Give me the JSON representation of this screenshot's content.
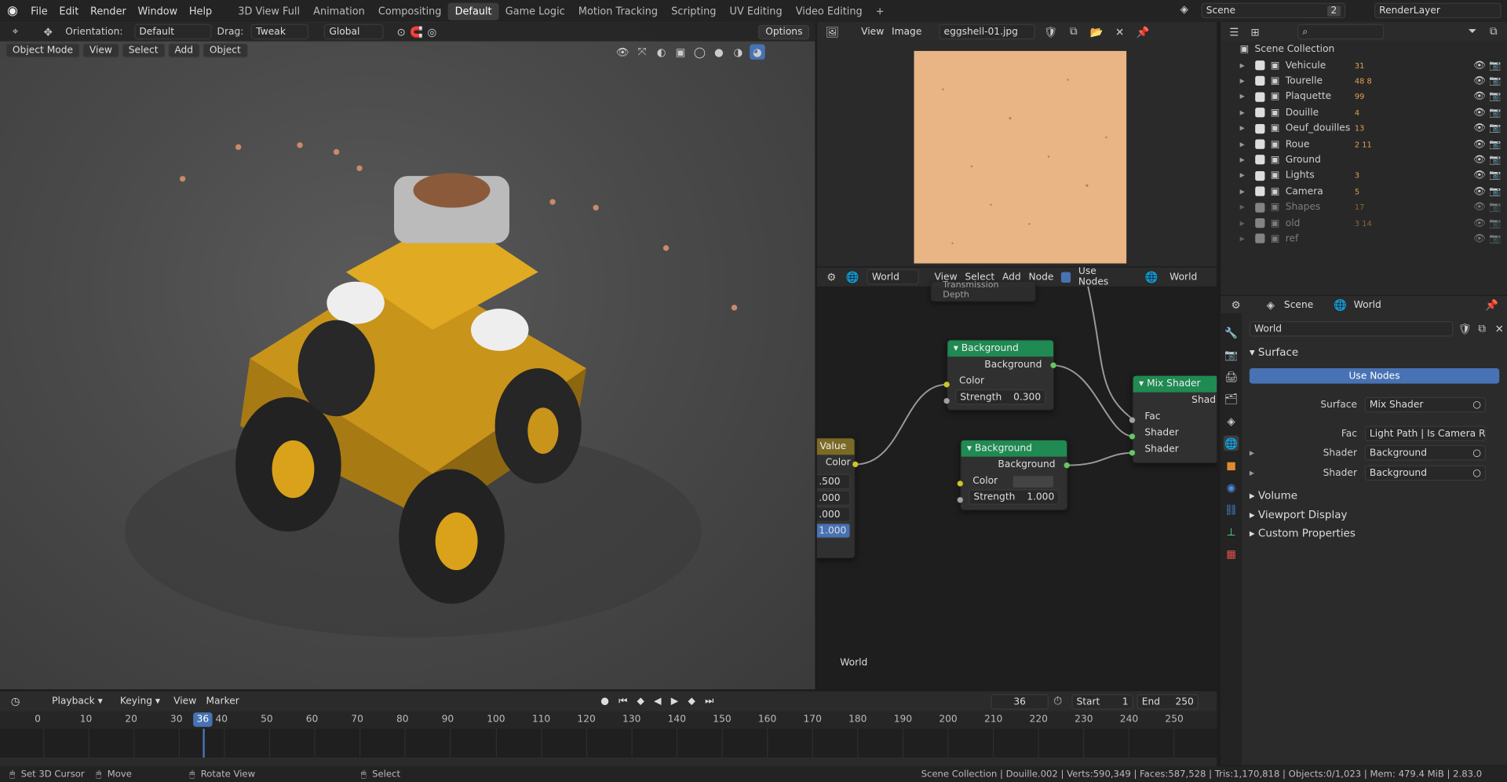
{
  "top_menu": [
    "File",
    "Edit",
    "Render",
    "Window",
    "Help"
  ],
  "workspaces": [
    "3D View Full",
    "Animation",
    "Compositing",
    "Default",
    "Game Logic",
    "Motion Tracking",
    "Scripting",
    "UV Editing",
    "Video Editing"
  ],
  "scene": {
    "label": "Scene",
    "count": "2",
    "render_layer": "RenderLayer"
  },
  "viewport_header": {
    "orientation_label": "Orientation:",
    "orientation_value": "Default",
    "drag_label": "Drag:",
    "drag_value": "Tweak",
    "transform": "Global",
    "options": "Options"
  },
  "viewport_sub": {
    "mode": "Object Mode",
    "items": [
      "View",
      "Select",
      "Add",
      "Object"
    ]
  },
  "image_editor": {
    "menus": [
      "View",
      "Image"
    ],
    "filename": "eggshell-01.jpg"
  },
  "node_editor": {
    "world_type": "World",
    "menus": [
      "View",
      "Select",
      "Add",
      "Node"
    ],
    "use_nodes": "Use Nodes",
    "world_name": "World",
    "footer": "World",
    "partial_label": "Transmission Depth"
  },
  "nodes": {
    "bg1": {
      "title": "Background",
      "out": "Background",
      "color": "Color",
      "strength_label": "Strength",
      "strength": "0.300"
    },
    "bg2": {
      "title": "Background",
      "out": "Background",
      "color": "Color",
      "strength_label": "Strength",
      "strength": "1.000"
    },
    "mix": {
      "title": "Mix Shader",
      "out": "Shad",
      "fac": "Fac",
      "shader1": "Shader",
      "shader2": "Shader"
    },
    "value": {
      "title": "Value",
      "out": "Color",
      "vals": [
        ".500",
        ".000",
        ".000",
        "1.000"
      ]
    }
  },
  "outliner": {
    "root": "Scene Collection",
    "items": [
      {
        "name": "Vehicule",
        "badges": "31",
        "dim": false
      },
      {
        "name": "Tourelle",
        "badges": "48 8",
        "dim": false
      },
      {
        "name": "Plaquette",
        "badges": "99",
        "dim": false
      },
      {
        "name": "Douille",
        "badges": "4",
        "dim": false
      },
      {
        "name": "Oeuf_douilles",
        "badges": "13",
        "dim": false
      },
      {
        "name": "Roue",
        "badges": "2 11",
        "dim": false
      },
      {
        "name": "Ground",
        "badges": "",
        "dim": false
      },
      {
        "name": "Lights",
        "badges": "3",
        "dim": false
      },
      {
        "name": "Camera",
        "badges": "5",
        "dim": false
      },
      {
        "name": "Shapes",
        "badges": "17",
        "dim": true
      },
      {
        "name": "old",
        "badges": "3 14",
        "dim": true
      },
      {
        "name": "ref",
        "badges": "",
        "dim": true
      }
    ]
  },
  "properties": {
    "tab_scene": "Scene",
    "tab_world": "World",
    "world_name": "World",
    "surface": "Surface",
    "use_nodes": "Use Nodes",
    "rows": [
      {
        "label": "Surface",
        "value": "Mix Shader"
      },
      {
        "label": "Fac",
        "value": "Light Path | Is Camera R..."
      },
      {
        "label": "Shader",
        "value": "Background"
      },
      {
        "label": "Shader",
        "value": "Background"
      }
    ],
    "panels": [
      "Volume",
      "Viewport Display",
      "Custom Properties"
    ]
  },
  "timeline": {
    "menus": [
      "Playback",
      "Keying",
      "View",
      "Marker"
    ],
    "current": "36",
    "start_label": "Start",
    "start": "1",
    "end_label": "End",
    "end": "250",
    "ticks": [
      "0",
      "10",
      "20",
      "30",
      "36",
      "40",
      "50",
      "60",
      "70",
      "80",
      "90",
      "100",
      "110",
      "120",
      "130",
      "140",
      "150",
      "160",
      "170",
      "180",
      "190",
      "200",
      "210",
      "220",
      "230",
      "240",
      "250"
    ]
  },
  "status": {
    "left": [
      "Set 3D Cursor",
      "Move",
      "Rotate View",
      "Select"
    ],
    "right": "Scene Collection | Douille.002 | Verts:590,349 | Faces:587,528 | Tris:1,170,818 | Objects:0/1,023 | Mem: 479.4 MiB | 2.83.0"
  },
  "colors": {
    "node_header": "#1f8a51",
    "value_header": "#7a6a25",
    "accent": "#4772b3",
    "vehicle": "#d9a21a"
  }
}
